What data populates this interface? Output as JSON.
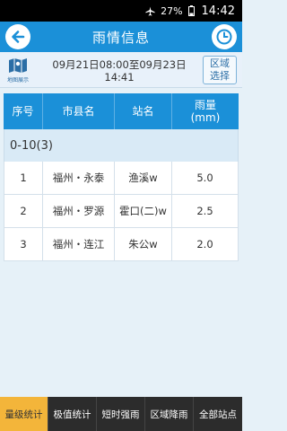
{
  "status_bar": {
    "battery": "27%",
    "time": "14:42"
  },
  "header": {
    "title": "雨情信息"
  },
  "info_bar": {
    "map_label": "地图展示",
    "date_range_line1": "09月21日08:00至09月23日",
    "date_range_line2": "14:41",
    "region_line1": "区域",
    "region_line2": "选择"
  },
  "table": {
    "columns": [
      "序号",
      "市县名",
      "站名",
      "雨量\n(mm)"
    ],
    "group_label": "0-10(3)",
    "rows": [
      [
        "1",
        "福州・永泰",
        "渔溪w",
        "5.0"
      ],
      [
        "2",
        "福州・罗源",
        "霍口(二)w",
        "2.5"
      ],
      [
        "3",
        "福州・连江",
        "朱公w",
        "2.0"
      ]
    ]
  },
  "tabs": [
    "量级统计",
    "极值统计",
    "短时强雨",
    "区域降雨",
    "全部站点"
  ],
  "colors": {
    "accent": "#1b90d8",
    "active_tab": "#f3b53a"
  }
}
